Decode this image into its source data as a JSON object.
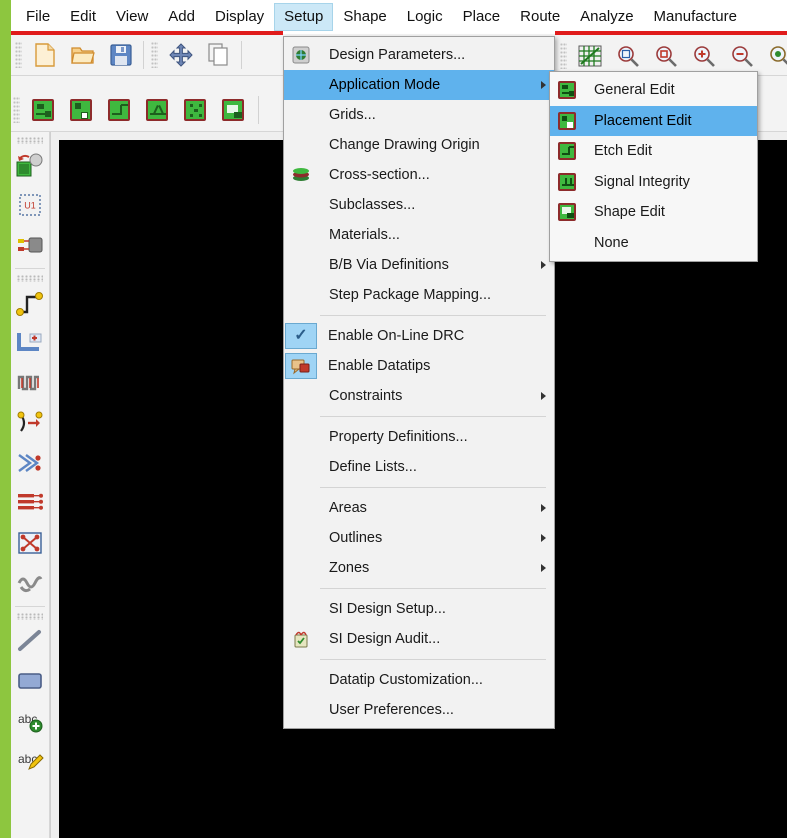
{
  "app": {
    "canvas_background": "#000000",
    "accent_green": "#8dc63f",
    "accent_red": "#e01b1b",
    "highlight_blue": "#5fb2ed",
    "menubar_active_bg": "#cce8f7"
  },
  "menubar": {
    "items": [
      {
        "label": "File",
        "active": false
      },
      {
        "label": "Edit",
        "active": false
      },
      {
        "label": "View",
        "active": false
      },
      {
        "label": "Add",
        "active": false
      },
      {
        "label": "Display",
        "active": false
      },
      {
        "label": "Setup",
        "active": true
      },
      {
        "label": "Shape",
        "active": false
      },
      {
        "label": "Logic",
        "active": false
      },
      {
        "label": "Place",
        "active": false
      },
      {
        "label": "Route",
        "active": false
      },
      {
        "label": "Analyze",
        "active": false
      },
      {
        "label": "Manufacture",
        "active": false
      }
    ]
  },
  "toolbar_row1": {
    "buttons": [
      {
        "name": "new-file-icon"
      },
      {
        "name": "open-folder-icon"
      },
      {
        "name": "save-disk-icon"
      },
      {
        "name": "move-icon"
      },
      {
        "name": "copy-icon"
      }
    ],
    "right_buttons": [
      {
        "name": "grid-toggle-icon"
      },
      {
        "name": "zoom-fit-icon"
      },
      {
        "name": "zoom-selection-icon"
      },
      {
        "name": "zoom-in-icon"
      },
      {
        "name": "zoom-out-icon"
      },
      {
        "name": "zoom-points-icon"
      }
    ]
  },
  "toolbar_row2": {
    "buttons": [
      {
        "name": "general-edit-mode-icon"
      },
      {
        "name": "placement-edit-mode-icon"
      },
      {
        "name": "etch-edit-mode-icon"
      },
      {
        "name": "signal-integrity-mode-icon"
      },
      {
        "name": "shape-edit-mode-icon"
      },
      {
        "name": "none-mode-icon"
      }
    ]
  },
  "side_toolbar": {
    "groups": [
      {
        "buttons": [
          {
            "name": "place-manual-icon"
          },
          {
            "name": "component-u1-icon"
          },
          {
            "name": "swap-components-icon"
          }
        ]
      },
      {
        "buttons": [
          {
            "name": "add-connect-icon"
          },
          {
            "name": "slide-trace-icon"
          },
          {
            "name": "delay-tune-icon"
          },
          {
            "name": "custom-smooth-icon"
          },
          {
            "name": "route-vision-icon"
          },
          {
            "name": "net-list-icon"
          },
          {
            "name": "via-array-icon"
          },
          {
            "name": "spread-between-voids-icon"
          }
        ]
      },
      {
        "buttons": [
          {
            "name": "add-line-icon"
          },
          {
            "name": "add-rectangle-icon"
          },
          {
            "name": "add-text-icon"
          },
          {
            "name": "edit-text-icon"
          }
        ]
      }
    ]
  },
  "setup_menu": {
    "title": "Setup",
    "items": [
      {
        "label": "Design Parameters...",
        "icon": "design-parameters-icon",
        "submenu": false,
        "checked": false,
        "separator_after": false
      },
      {
        "label": "Application Mode",
        "icon": null,
        "submenu": true,
        "selected": true,
        "checked": false,
        "separator_after": false
      },
      {
        "label": "Grids...",
        "icon": null,
        "submenu": false,
        "checked": false,
        "separator_after": false
      },
      {
        "label": "Change Drawing Origin",
        "icon": null,
        "submenu": false,
        "checked": false,
        "separator_after": false
      },
      {
        "label": "Cross-section...",
        "icon": "cross-section-icon",
        "submenu": false,
        "checked": false,
        "separator_after": false
      },
      {
        "label": "Subclasses...",
        "icon": null,
        "submenu": false,
        "checked": false,
        "separator_after": false
      },
      {
        "label": "Materials...",
        "icon": null,
        "submenu": false,
        "checked": false,
        "separator_after": false
      },
      {
        "label": "B/B Via Definitions",
        "icon": null,
        "submenu": true,
        "checked": false,
        "separator_after": false
      },
      {
        "label": "Step Package Mapping...",
        "icon": null,
        "submenu": false,
        "checked": false,
        "separator_after": true
      },
      {
        "label": "Enable On-Line DRC",
        "icon": "checkmark-icon",
        "submenu": false,
        "checked": true,
        "separator_after": false
      },
      {
        "label": "Enable Datatips",
        "icon": "datatips-icon",
        "submenu": false,
        "checked": true,
        "separator_after": false
      },
      {
        "label": "Constraints",
        "icon": null,
        "submenu": true,
        "checked": false,
        "separator_after": true
      },
      {
        "label": "Property Definitions...",
        "icon": null,
        "submenu": false,
        "checked": false,
        "separator_after": false
      },
      {
        "label": "Define Lists...",
        "icon": null,
        "submenu": false,
        "checked": false,
        "separator_after": true
      },
      {
        "label": "Areas",
        "icon": null,
        "submenu": true,
        "checked": false,
        "separator_after": false
      },
      {
        "label": "Outlines",
        "icon": null,
        "submenu": true,
        "checked": false,
        "separator_after": false
      },
      {
        "label": "Zones",
        "icon": null,
        "submenu": true,
        "checked": false,
        "separator_after": true
      },
      {
        "label": "SI Design Setup...",
        "icon": null,
        "submenu": false,
        "checked": false,
        "separator_after": false
      },
      {
        "label": "SI Design Audit...",
        "icon": "si-design-audit-icon",
        "submenu": false,
        "checked": false,
        "separator_after": true
      },
      {
        "label": "Datatip Customization...",
        "icon": null,
        "submenu": false,
        "checked": false,
        "separator_after": false
      },
      {
        "label": "User Preferences...",
        "icon": null,
        "submenu": false,
        "checked": false,
        "separator_after": false
      }
    ]
  },
  "application_mode_submenu": {
    "items": [
      {
        "label": "General Edit",
        "icon": "general-edit-icon",
        "selected": false
      },
      {
        "label": "Placement Edit",
        "icon": "placement-edit-icon",
        "selected": true
      },
      {
        "label": "Etch Edit",
        "icon": "etch-edit-icon",
        "selected": false
      },
      {
        "label": "Signal Integrity",
        "icon": "signal-integrity-icon",
        "selected": false
      },
      {
        "label": "Shape Edit",
        "icon": "shape-edit-icon",
        "selected": false
      },
      {
        "label": "None",
        "icon": null,
        "selected": false
      }
    ]
  }
}
